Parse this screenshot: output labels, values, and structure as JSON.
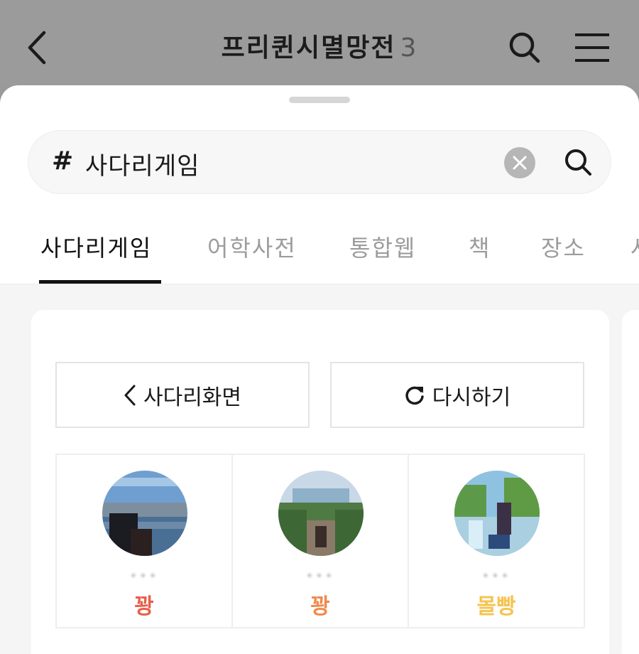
{
  "header": {
    "title": "프리퀸시멸망전",
    "member_count": "3",
    "back_icon": "chevron-left-icon",
    "search_icon": "search-icon",
    "menu_icon": "hamburger-menu-icon"
  },
  "search": {
    "hash": "#",
    "query": "사다리게임"
  },
  "tabs": [
    {
      "label": "사다리게임",
      "active": true
    },
    {
      "label": "어학사전"
    },
    {
      "label": "통합웹"
    },
    {
      "label": "책"
    },
    {
      "label": "장소"
    },
    {
      "label": "사"
    }
  ],
  "buttons": {
    "ladder_screen": "사다리화면",
    "retry": "다시하기"
  },
  "results": [
    {
      "name": "•••",
      "result": "꽝",
      "color": "#e85f4a"
    },
    {
      "name": "•••",
      "result": "꽝",
      "color": "#f08a4b"
    },
    {
      "name": "•••",
      "result": "몰빵",
      "color": "#f5c451"
    }
  ],
  "colors": {
    "accent_red": "#e85f4a",
    "accent_orange": "#f08a4b",
    "accent_yellow": "#f5c451"
  }
}
